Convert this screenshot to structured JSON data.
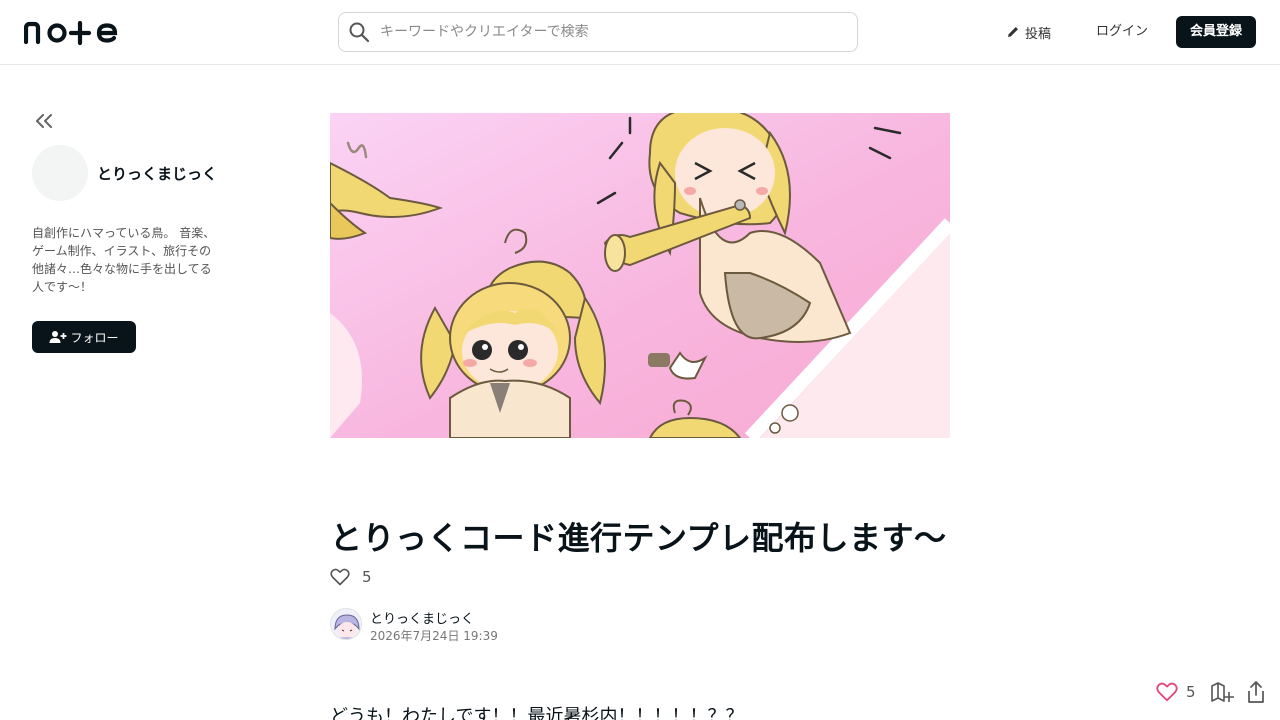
{
  "header": {
    "logo_text": "note",
    "search_placeholder": "キーワードやクリエイターで検索",
    "post_label": "投稿",
    "login_label": "ログイン",
    "signup_label": "会員登録"
  },
  "sidebar": {
    "creator_name": "とりっくまじっく",
    "bio": "自創作にハマっている鳥。 音楽、ゲーム制作、イラスト、旅行その他諸々…色々な物に手を出してる人です〜！",
    "follow_label": "フォロー"
  },
  "article": {
    "title": "とりっくコード進行テンプレ配布します〜",
    "like_count": "5",
    "author_name": "とりっくまじっく",
    "published": "2026年7月24日 19:39",
    "first_line": "どうも！わたしです！！最近暑杉内！！！！！？？"
  },
  "floating": {
    "like_count": "5"
  },
  "icons": {
    "search": "search-icon",
    "pen": "pen-icon",
    "collapse": "double-chevron-left-icon",
    "follow": "user-plus-icon",
    "heart": "heart-icon",
    "magazine": "add-to-magazine-icon",
    "share": "share-icon"
  },
  "colors": {
    "primary": "#08131a",
    "heart_accent": "#e0457b",
    "border": "#e6e6e6"
  }
}
